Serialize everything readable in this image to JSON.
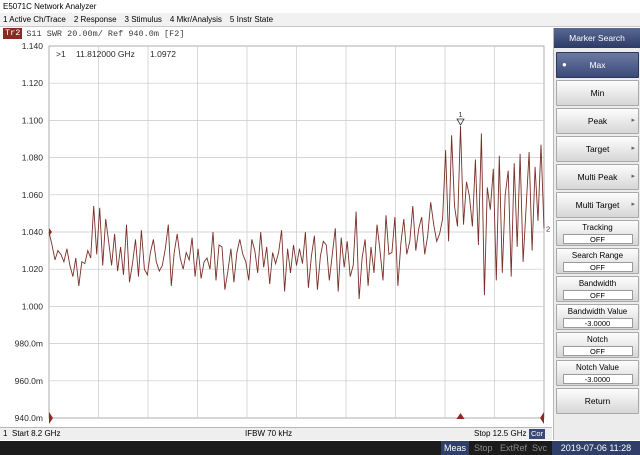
{
  "window": {
    "title": "E5071C Network Analyzer"
  },
  "menu": [
    "1 Active Ch/Trace",
    "2 Response",
    "3 Stimulus",
    "4 Mkr/Analysis",
    "5 Instr State"
  ],
  "trace": {
    "tag": "Tr2",
    "header": "S11  SWR 20.00m/ Ref 940.0m [F2]"
  },
  "marker": {
    "readout_index": ">1",
    "readout_freq": "11.812000 GHz",
    "readout_value": "1.0972",
    "label": "1",
    "end_label": "2"
  },
  "axis": {
    "y_ticks": [
      "1.140",
      "1.120",
      "1.100",
      "1.080",
      "1.060",
      "1.040",
      "1.020",
      "1.000",
      "980.0m",
      "960.0m",
      "940.0m"
    ]
  },
  "colors": {
    "trace": "#7a3028",
    "panel_accent": "#3b4a78",
    "marker": "#8b2a22"
  },
  "chart_data": {
    "type": "line",
    "xlim": [
      8.2,
      12.5
    ],
    "ylim": [
      0.94,
      1.14
    ],
    "grid": true,
    "series": [
      {
        "name": "S11",
        "y": [
          1.04,
          1.033,
          1.025,
          1.03,
          1.028,
          1.024,
          1.031,
          1.022,
          1.016,
          1.026,
          1.011,
          1.024,
          1.023,
          1.03,
          1.026,
          1.054,
          1.028,
          1.053,
          1.022,
          1.047,
          1.035,
          1.022,
          1.039,
          1.019,
          1.032,
          1.017,
          1.044,
          1.013,
          1.023,
          1.036,
          1.016,
          1.041,
          1.02,
          1.017,
          1.029,
          1.036,
          1.024,
          1.019,
          1.022,
          1.031,
          1.044,
          1.011,
          1.029,
          1.039,
          1.026,
          1.02,
          1.029,
          1.025,
          1.037,
          1.016,
          1.031,
          1.015,
          1.024,
          1.026,
          1.02,
          1.04,
          1.014,
          1.033,
          1.032,
          1.009,
          1.019,
          1.031,
          1.013,
          1.029,
          1.036,
          1.028,
          1.024,
          1.014,
          1.036,
          1.03,
          1.018,
          1.04,
          1.021,
          1.032,
          1.012,
          1.029,
          1.023,
          1.029,
          1.041,
          1.008,
          1.031,
          1.018,
          1.033,
          1.022,
          1.031,
          1.023,
          1.04,
          1.01,
          1.027,
          1.038,
          1.009,
          1.027,
          1.035,
          1.033,
          1.014,
          1.028,
          1.042,
          1.008,
          1.037,
          1.021,
          1.035,
          1.016,
          1.022,
          1.051,
          1.004,
          1.026,
          1.036,
          1.011,
          1.032,
          1.018,
          1.044,
          1.03,
          1.014,
          1.049,
          1.028,
          1.029,
          1.048,
          1.011,
          1.034,
          1.047,
          1.028,
          1.035,
          1.054,
          1.03,
          1.042,
          1.048,
          1.028,
          1.038,
          1.056,
          1.044,
          1.035,
          1.039,
          1.047,
          1.084,
          1.035,
          1.092,
          1.054,
          1.043,
          1.097,
          1.044,
          1.067,
          1.059,
          1.043,
          1.079,
          1.033,
          1.093,
          1.006,
          1.064,
          1.052,
          1.074,
          1.014,
          1.081,
          1.018,
          1.06,
          1.073,
          1.016,
          1.077,
          1.032,
          1.082,
          1.024,
          1.053,
          1.083,
          1.03,
          1.075,
          1.046,
          1.087,
          1.042
        ]
      }
    ]
  },
  "status": {
    "channel": "1",
    "start": "Start 8.2 GHz",
    "ifbw": "IFBW 70 kHz",
    "stop": "Stop 12.5 GHz",
    "cor": "Cor",
    "meas": "Meas",
    "stop_state": "Stop",
    "extref": "ExtRef",
    "svc": "Svc",
    "datetime": "2019-07-06 11:28"
  },
  "panel": {
    "title": "Marker Search",
    "buttons": [
      {
        "label": "Max",
        "active": true
      },
      {
        "label": "Min"
      },
      {
        "label": "Peak",
        "arrow": true
      },
      {
        "label": "Target",
        "arrow": true
      },
      {
        "label": "Multi Peak",
        "arrow": true
      },
      {
        "label": "Multi Target",
        "arrow": true
      }
    ],
    "tracking": {
      "label": "Tracking",
      "value": "OFF"
    },
    "search_range": {
      "label": "Search Range",
      "value": "OFF"
    },
    "bandwidth": {
      "label": "Bandwidth",
      "value": "OFF"
    },
    "bandwidth_value": {
      "label": "Bandwidth Value",
      "value": "-3.0000"
    },
    "notch": {
      "label": "Notch",
      "value": "OFF"
    },
    "notch_value": {
      "label": "Notch Value",
      "value": "-3.0000"
    },
    "return_label": "Return"
  }
}
